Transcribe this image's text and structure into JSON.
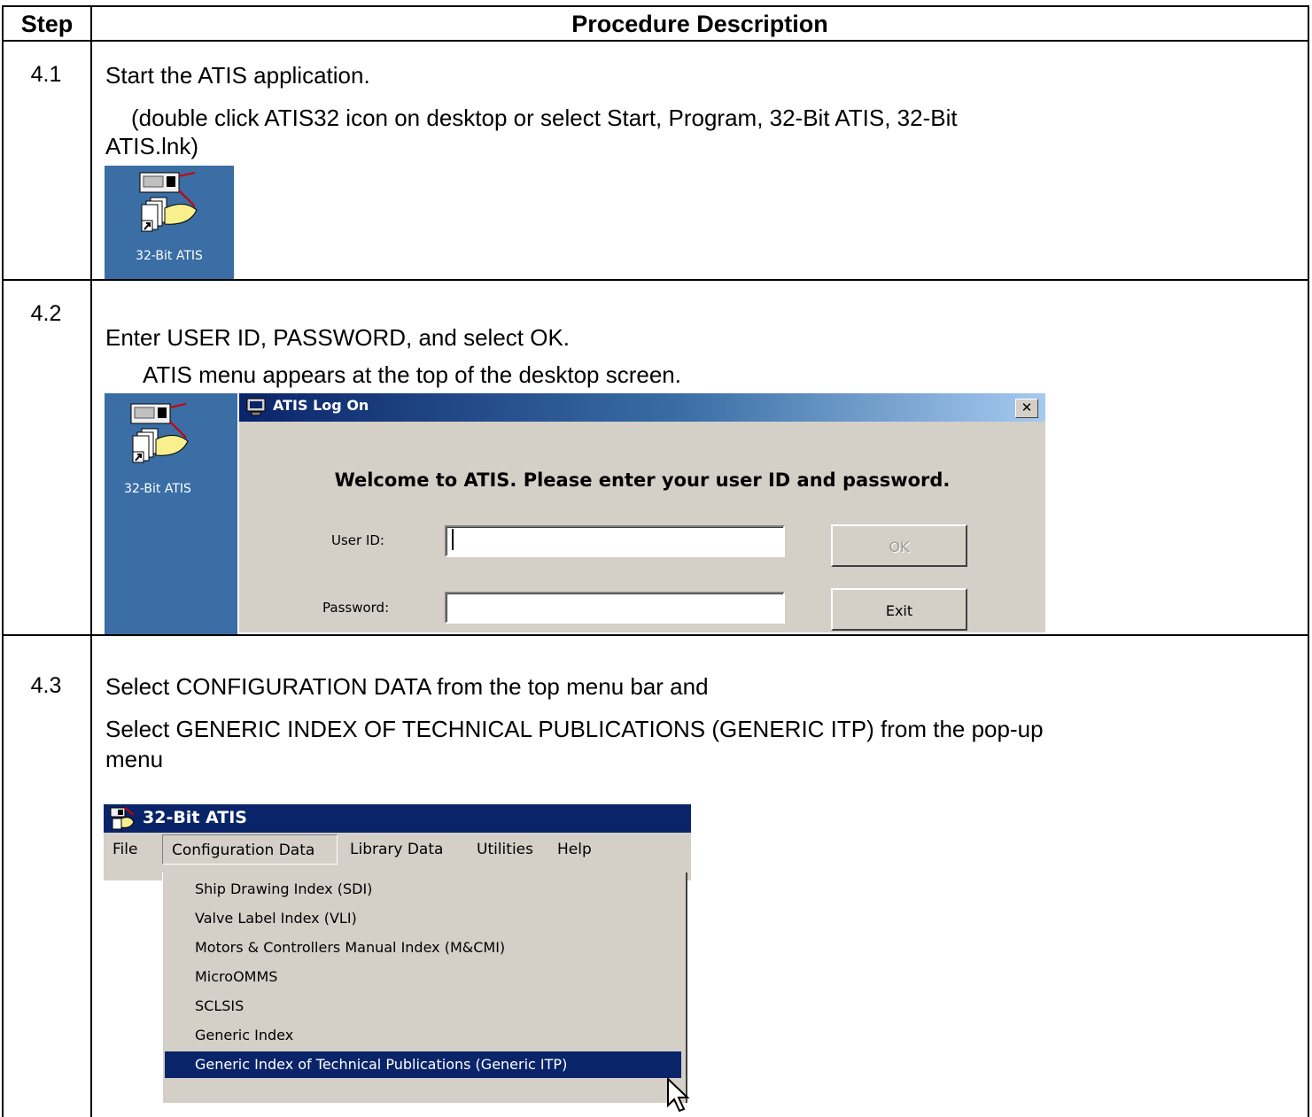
{
  "table": {
    "header_step": "Step",
    "header_description": "Procedure Description"
  },
  "step1": {
    "number": "4.1",
    "line1": "Start the ATIS application.",
    "line2": "(double click ATIS32 icon on desktop or select Start, Program, 32-Bit ATIS, 32-Bit",
    "line3": "ATIS.lnk)",
    "icon_label": "32-Bit ATIS"
  },
  "step2": {
    "number": "4.2",
    "line1": "Enter USER ID, PASSWORD, and select OK.",
    "line2": "ATIS menu appears at the top of the desktop screen.",
    "icon_label": "32-Bit ATIS",
    "dialog": {
      "title": "ATIS Log On",
      "close": "✕",
      "welcome": "Welcome to ATIS.  Please enter your user ID and password.",
      "user_id_label": "User ID:",
      "password_label": "Password:",
      "user_id_value": "",
      "password_value": "",
      "ok_label": "OK",
      "exit_label": "Exit"
    }
  },
  "step3": {
    "number": "4.3",
    "line1": "Select CONFIGURATION DATA from the top menu bar and",
    "line2": "Select GENERIC INDEX OF TECHNICAL PUBLICATIONS (GENERIC ITP) from the pop-up",
    "line3": "menu",
    "app": {
      "title": "32-Bit ATIS",
      "menu": [
        "File",
        "Configuration Data",
        "Library Data",
        "Utilities",
        "Help"
      ],
      "active_menu": "Configuration Data",
      "dropdown": [
        "Ship Drawing Index (SDI)",
        "Valve Label Index (VLI)",
        "Motors & Controllers Manual Index (M&CMI)",
        "MicroOMMS",
        "SCLSIS",
        "Generic Index",
        "Generic Index of Technical Publications (Generic ITP)"
      ],
      "selected_item": "Generic Index of Technical Publications (Generic ITP)"
    }
  },
  "colors": {
    "desktop_blue": "#3a6ea5",
    "titlebar_navy": "#0a246a",
    "dialog_gray": "#d4d0c8"
  },
  "icons": [
    "atis-shortcut-icon",
    "atis-app-icon",
    "close-icon",
    "mouse-pointer-icon"
  ]
}
